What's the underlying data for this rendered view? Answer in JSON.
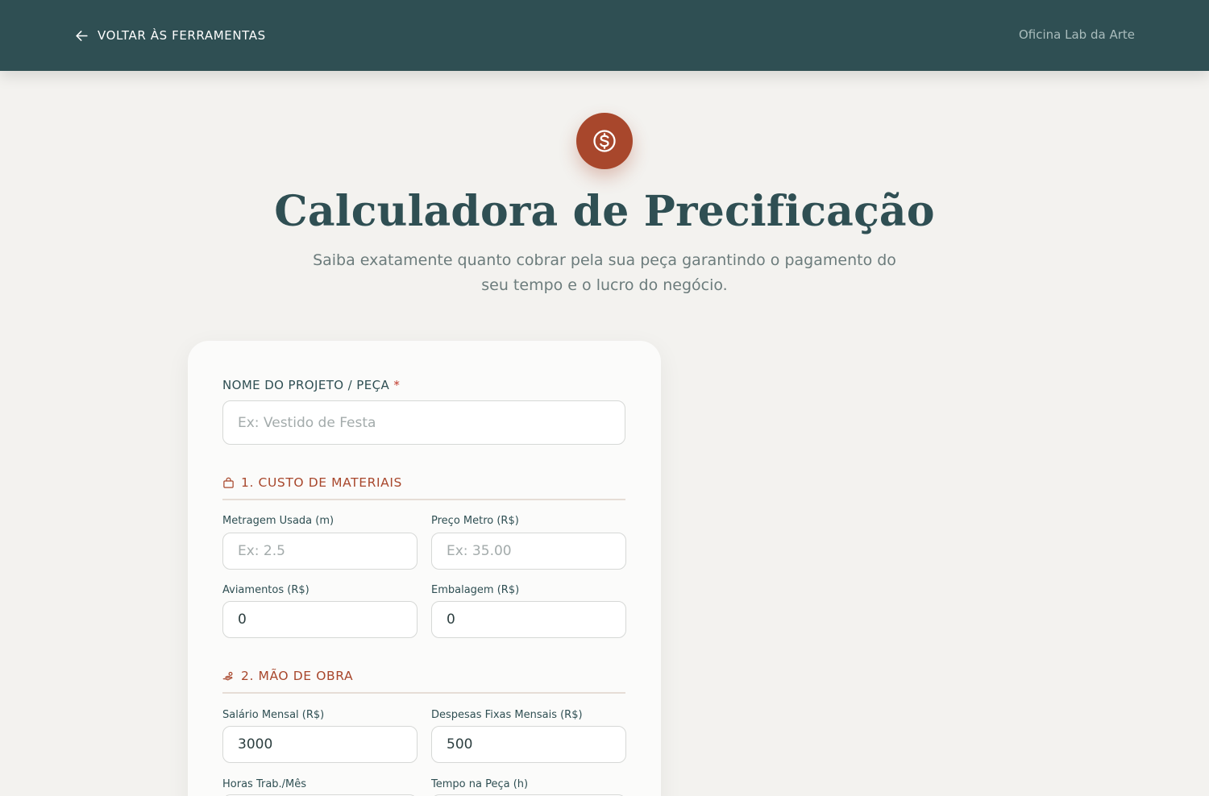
{
  "header": {
    "back_label": "VOLTAR ÀS FERRAMENTAS",
    "brand": "Oficina Lab da Arte"
  },
  "hero": {
    "icon": "dollar-circle-icon",
    "title": "Calculadora de Precificação",
    "subtitle": "Saiba exatamente quanto cobrar pela sua peça garantindo o pagamento do seu tempo e o lucro do negócio."
  },
  "form": {
    "project": {
      "label": "NOME DO PROJETO / PEÇA",
      "required_mark": "*",
      "placeholder": "Ex: Vestido de Festa",
      "value": ""
    },
    "materials": {
      "title": "1. CUSTO DE MATERIAIS",
      "icon": "shopping-bag-icon",
      "fields": [
        {
          "label": "Metragem Usada (m)",
          "placeholder": "Ex: 2.5",
          "value": ""
        },
        {
          "label": "Preço Metro (R$)",
          "placeholder": "Ex: 35.00",
          "value": ""
        },
        {
          "label": "Aviamentos (R$)",
          "placeholder": "",
          "value": "0"
        },
        {
          "label": "Embalagem (R$)",
          "placeholder": "",
          "value": "0"
        }
      ]
    },
    "labor": {
      "title": "2. MÃO DE OBRA",
      "icon": "hand-coins-icon",
      "fields": [
        {
          "label": "Salário Mensal (R$)",
          "placeholder": "",
          "value": "3000"
        },
        {
          "label": "Despesas Fixas Mensais (R$)",
          "placeholder": "",
          "value": "500"
        },
        {
          "label": "Horas Trab./Mês",
          "placeholder": "",
          "value": ""
        },
        {
          "label": "Tempo na Peça (h)",
          "placeholder": "",
          "value": ""
        }
      ]
    }
  },
  "colors": {
    "header_bg": "#2f4f53",
    "accent": "#a8472c",
    "page_bg": "#f3f2ef"
  }
}
